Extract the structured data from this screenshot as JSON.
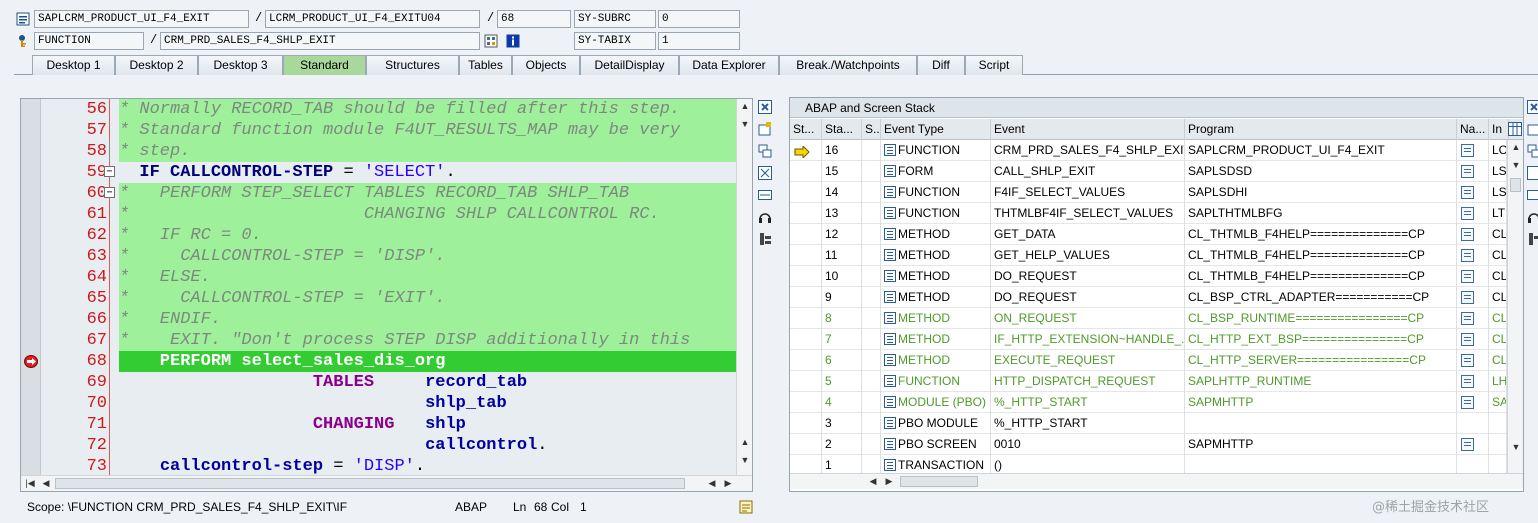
{
  "top_fields": {
    "row1": {
      "program": "SAPLCRM_PRODUCT_UI_F4_EXIT",
      "include": "LCRM_PRODUCT_UI_F4_EXITU04",
      "line": "68",
      "var_name": "SY-SUBRC",
      "var_value": "0"
    },
    "row2": {
      "event_type": "FUNCTION",
      "event": "CRM_PRD_SALES_F4_SHLP_EXIT",
      "var_name": "SY-TABIX",
      "var_value": "1"
    }
  },
  "tabs": [
    {
      "label": "Desktop 1"
    },
    {
      "label": "Desktop 2"
    },
    {
      "label": "Desktop 3"
    },
    {
      "label": "Standard"
    },
    {
      "label": "Structures"
    },
    {
      "label": "Tables"
    },
    {
      "label": "Objects"
    },
    {
      "label": "DetailDisplay"
    },
    {
      "label": "Data Explorer"
    },
    {
      "label": "Break./Watchpoints"
    },
    {
      "label": "Diff"
    },
    {
      "label": "Script"
    }
  ],
  "active_tab": "Standard",
  "editor": {
    "lines": [
      {
        "no": "56",
        "text": "* Normally RECORD_TAB should be filled after this step."
      },
      {
        "no": "57",
        "text": "* Standard function module F4UT_RESULTS_MAP may be very"
      },
      {
        "no": "58",
        "text": "* step."
      },
      {
        "no": "59",
        "text": "  IF CALLCONTROL-STEP = 'SELECT'."
      },
      {
        "no": "60",
        "text": "*   PERFORM STEP_SELECT TABLES RECORD_TAB SHLP_TAB"
      },
      {
        "no": "61",
        "text": "*                       CHANGING SHLP CALLCONTROL RC."
      },
      {
        "no": "62",
        "text": "*   IF RC = 0."
      },
      {
        "no": "63",
        "text": "*     CALLCONTROL-STEP = 'DISP'."
      },
      {
        "no": "64",
        "text": "*   ELSE."
      },
      {
        "no": "65",
        "text": "*     CALLCONTROL-STEP = 'EXIT'."
      },
      {
        "no": "66",
        "text": "*   ENDIF."
      },
      {
        "no": "67",
        "text": "*    EXIT. \"Don't process STEP DISP additionally in this"
      },
      {
        "no": "68",
        "text": "    PERFORM select_sales_dis_org"
      },
      {
        "no": "69",
        "text": "                   TABLES     record_tab"
      },
      {
        "no": "70",
        "text": "                              shlp_tab"
      },
      {
        "no": "71",
        "text": "                   CHANGING   shlp"
      },
      {
        "no": "72",
        "text": "                              callcontrol."
      },
      {
        "no": "73",
        "text": "    callcontrol-step = 'DISP'."
      }
    ]
  },
  "status_bar": {
    "scope": "Scope: \\FUNCTION CRM_PRD_SALES_F4_SHLP_EXIT\\IF",
    "language": "ABAP",
    "ln_label": "Ln",
    "ln_value": "68",
    "col_label": "Col",
    "col_value": "1"
  },
  "stack_panel": {
    "title": "ABAP and Screen Stack",
    "columns": [
      "St...",
      "Sta...",
      "S...",
      "Event Type",
      "Event",
      "Program",
      "Na...",
      "In"
    ],
    "rows": [
      {
        "stack": "16",
        "type": "FUNCTION",
        "event": "CRM_PRD_SALES_F4_SHLP_EXIT",
        "program": "SAPLCRM_PRODUCT_UI_F4_EXIT",
        "inc": "LC",
        "nav": true,
        "dim": false,
        "current": true
      },
      {
        "stack": "15",
        "type": "FORM",
        "event": "CALL_SHLP_EXIT",
        "program": "SAPLSDSD",
        "inc": "LS",
        "nav": true,
        "dim": false,
        "current": false
      },
      {
        "stack": "14",
        "type": "FUNCTION",
        "event": "F4IF_SELECT_VALUES",
        "program": "SAPLSDHI",
        "inc": "LS",
        "nav": true,
        "dim": false,
        "current": false
      },
      {
        "stack": "13",
        "type": "FUNCTION",
        "event": "THTMLBF4IF_SELECT_VALUES",
        "program": "SAPLTHTMLBFG",
        "inc": "LT",
        "nav": true,
        "dim": false,
        "current": false
      },
      {
        "stack": "12",
        "type": "METHOD",
        "event": "GET_DATA",
        "program": "CL_THTMLB_F4HELP==============CP",
        "inc": "CL",
        "nav": true,
        "dim": false,
        "current": false
      },
      {
        "stack": "11",
        "type": "METHOD",
        "event": "GET_HELP_VALUES",
        "program": "CL_THTMLB_F4HELP==============CP",
        "inc": "CL",
        "nav": true,
        "dim": false,
        "current": false
      },
      {
        "stack": "10",
        "type": "METHOD",
        "event": "DO_REQUEST",
        "program": "CL_THTMLB_F4HELP==============CP",
        "inc": "CL",
        "nav": true,
        "dim": false,
        "current": false
      },
      {
        "stack": "9",
        "type": "METHOD",
        "event": "DO_REQUEST",
        "program": "CL_BSP_CTRL_ADAPTER===========CP",
        "inc": "CL",
        "nav": true,
        "dim": false,
        "current": false
      },
      {
        "stack": "8",
        "type": "METHOD",
        "event": "ON_REQUEST",
        "program": "CL_BSP_RUNTIME================CP",
        "inc": "CL",
        "nav": true,
        "dim": true,
        "current": false
      },
      {
        "stack": "7",
        "type": "METHOD",
        "event": "IF_HTTP_EXTENSION~HANDLE_...",
        "program": "CL_HTTP_EXT_BSP===============CP",
        "inc": "CL",
        "nav": true,
        "dim": true,
        "current": false
      },
      {
        "stack": "6",
        "type": "METHOD",
        "event": "EXECUTE_REQUEST",
        "program": "CL_HTTP_SERVER================CP",
        "inc": "CL",
        "nav": true,
        "dim": true,
        "current": false
      },
      {
        "stack": "5",
        "type": "FUNCTION",
        "event": "HTTP_DISPATCH_REQUEST",
        "program": "SAPLHTTP_RUNTIME",
        "inc": "LH",
        "nav": true,
        "dim": true,
        "current": false
      },
      {
        "stack": "4",
        "type": "MODULE (PBO)",
        "event": "%_HTTP_START",
        "program": "SAPMHTTP",
        "inc": "SA",
        "nav": true,
        "dim": true,
        "current": false
      },
      {
        "stack": "3",
        "type": "PBO MODULE",
        "event": "%_HTTP_START",
        "program": "",
        "inc": "",
        "nav": false,
        "dim": false,
        "current": false
      },
      {
        "stack": "2",
        "type": "PBO SCREEN",
        "event": "0010",
        "program": "SAPMHTTP",
        "inc": "",
        "nav": true,
        "dim": false,
        "current": false
      },
      {
        "stack": "1",
        "type": "TRANSACTION",
        "event": "()",
        "program": "",
        "inc": "",
        "nav": false,
        "dim": false,
        "current": false
      }
    ]
  },
  "watermark": "@稀土掘金技术社区",
  "colors": {
    "comment_bg": "#9ff09a",
    "current_line_bg": "#33cc33",
    "active_tab": "#a9d99a",
    "line_number": "#d01818",
    "dim_row_text": "#4e9a2a"
  }
}
